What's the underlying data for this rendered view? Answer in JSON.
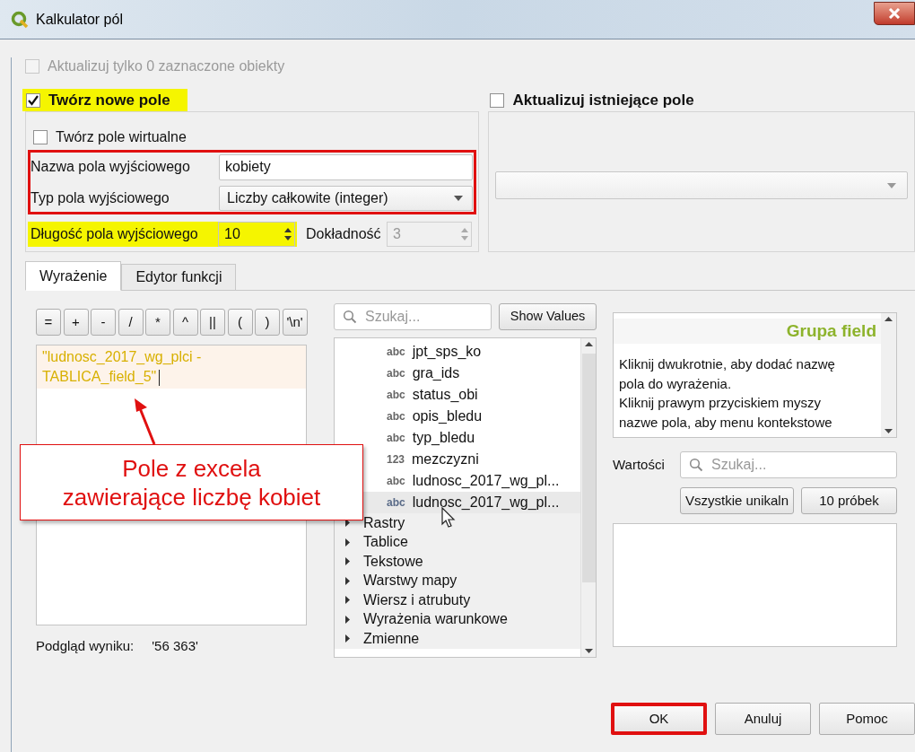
{
  "window": {
    "title": "Kalkulator pól"
  },
  "only_selected": {
    "label": "Aktualizuj tylko 0 zaznaczone obiekty",
    "checked": false,
    "disabled": true
  },
  "create_new": {
    "label": "Twórz nowe pole",
    "checked": true,
    "highlighted": true,
    "virtual": {
      "label": "Twórz pole wirtualne",
      "checked": false
    },
    "name_type_framed": true,
    "name": {
      "label": "Nazwa pola wyjściowego",
      "value": "kobiety"
    },
    "type": {
      "label": "Typ pola wyjściowego",
      "value": "Liczby całkowite (integer)"
    },
    "length": {
      "label": "Długość pola wyjściowego",
      "value": "10",
      "highlighted": true
    },
    "precision": {
      "label": "Dokładność",
      "value": "3",
      "disabled": true
    }
  },
  "update_existing": {
    "label": "Aktualizuj istniejące pole",
    "checked": false
  },
  "tabs": [
    {
      "label": "Wyrażenie",
      "selected": true
    },
    {
      "label": "Edytor funkcji",
      "selected": false
    }
  ],
  "operators": [
    "=",
    "+",
    "-",
    "/",
    "*",
    "^",
    "||",
    "(",
    ")",
    "'\\n'"
  ],
  "expression": "\"ludnosc_2017_wg_plci - TABLICA_field_5\"",
  "preview": {
    "label": "Podgląd wyniku:",
    "value": "'56 363'"
  },
  "function_search": {
    "placeholder": "Szukaj..."
  },
  "show_values": "Show Values",
  "tree": [
    {
      "kind": "field",
      "type_label": "abc",
      "label": "jpt_sps_ko",
      "selected": false
    },
    {
      "kind": "field",
      "type_label": "abc",
      "label": "gra_ids",
      "selected": false
    },
    {
      "kind": "field",
      "type_label": "abc",
      "label": "status_obi",
      "selected": false
    },
    {
      "kind": "field",
      "type_label": "abc",
      "label": "opis_bledu",
      "selected": false
    },
    {
      "kind": "field",
      "type_label": "abc",
      "label": "typ_bledu",
      "selected": false
    },
    {
      "kind": "field",
      "type_label": "123",
      "label": "mezczyzni",
      "selected": false
    },
    {
      "kind": "field",
      "type_label": "abc",
      "label": "ludnosc_2017_wg_pl...",
      "selected": false
    },
    {
      "kind": "field",
      "type_label": "abc",
      "label": "ludnosc_2017_wg_pl...",
      "selected": true
    },
    {
      "kind": "group",
      "label": "Rastry",
      "expanded": false
    },
    {
      "kind": "group",
      "label": "Tablice",
      "expanded": false
    },
    {
      "kind": "group",
      "label": "Tekstowe",
      "expanded": false
    },
    {
      "kind": "group",
      "label": "Warstwy mapy",
      "expanded": false
    },
    {
      "kind": "group",
      "label": "Wiersz i atrubuty",
      "expanded": false
    },
    {
      "kind": "group",
      "label": "Wyrażenia warunkowe",
      "expanded": false
    },
    {
      "kind": "group",
      "label": "Zmienne",
      "expanded": false
    }
  ],
  "help": {
    "title": "Grupa field",
    "lines": [
      "Kliknij dwukrotnie, aby dodać nazwę",
      "pola do wyrażenia.",
      "Kliknij prawym przyciskiem myszy",
      "nazwe pola, aby menu kontekstowe"
    ]
  },
  "values": {
    "label": "Wartości",
    "placeholder": "Szukaj...",
    "buttons": [
      "Vszystkie unikaln",
      "10 próbek"
    ]
  },
  "annotation": {
    "lines": [
      "Pole z excela",
      "zawierające liczbę kobiet"
    ]
  },
  "buttons": [
    {
      "label": "OK",
      "highlighted": true
    },
    {
      "label": "Anuluj",
      "highlighted": false
    },
    {
      "label": "Pomoc",
      "highlighted": false
    }
  ]
}
